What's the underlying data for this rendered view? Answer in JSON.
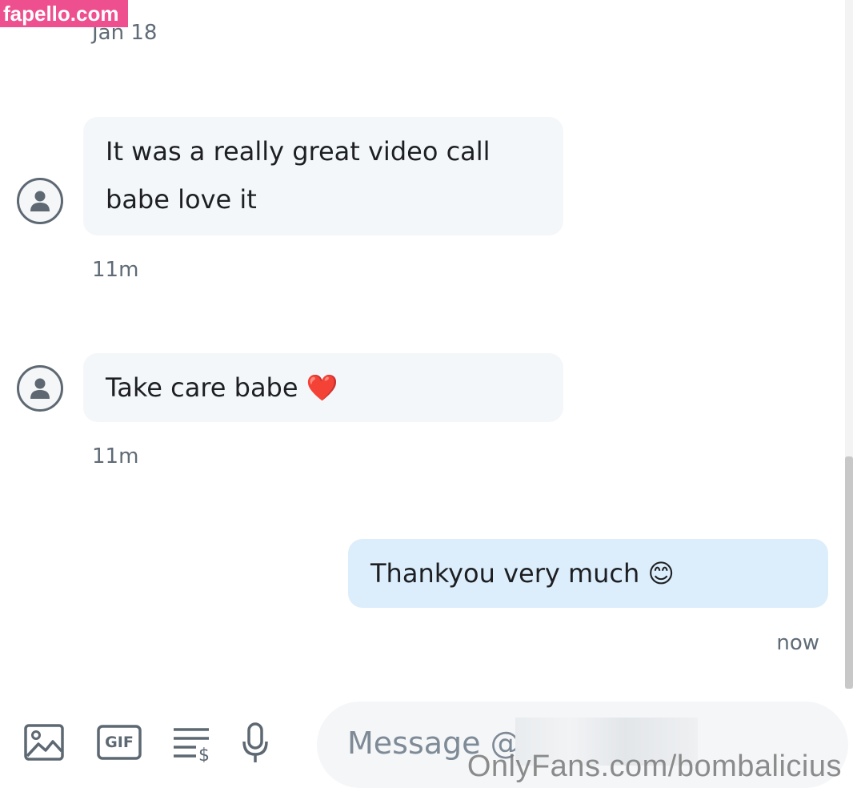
{
  "watermark_top": "fapello.com",
  "date_divider": "Jan 18",
  "messages": [
    {
      "direction": "in",
      "lines": [
        "It was a really great video call",
        "babe love it"
      ],
      "time": "11m"
    },
    {
      "direction": "in",
      "text": "Take care babe",
      "emoji": "❤️",
      "time": "11m"
    },
    {
      "direction": "out",
      "text": "Thankyou very much",
      "emoji": "😊",
      "time": "now"
    }
  ],
  "composer": {
    "placeholder": "Message @"
  },
  "toolbar": {
    "icons": [
      "image-icon",
      "gif-icon",
      "price-list-icon",
      "microphone-icon"
    ],
    "gif_label": "GIF"
  },
  "watermark_bottom": "OnlyFans.com/bombalicius",
  "colors": {
    "incoming_bubble": "#f4f7f9",
    "outgoing_bubble": "#dcedfb",
    "icon_gray": "#5d6872",
    "watermark_pink": "#ee4f8f"
  }
}
